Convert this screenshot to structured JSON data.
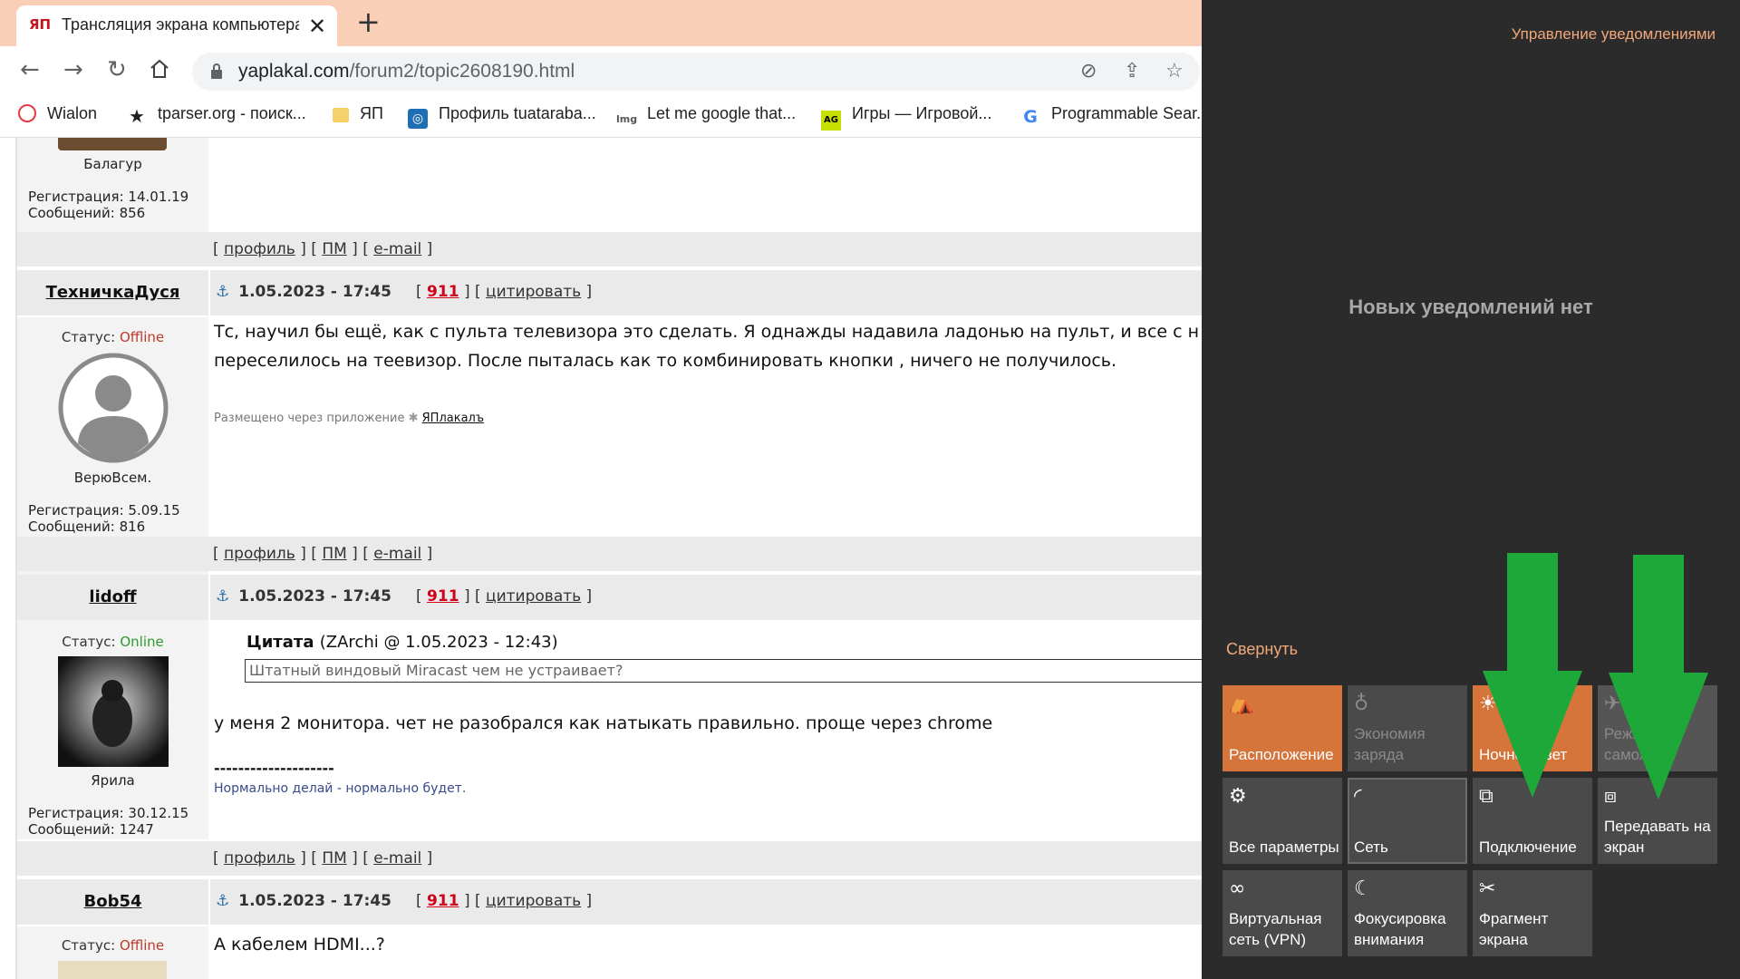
{
  "browser": {
    "tab_title": "Трансляция экрана компьютера",
    "tab_favicon": "ЯП",
    "close_glyph": "✕",
    "newtab_glyph": "+",
    "url_host": "yaplakal.com",
    "url_path": "/forum2/topic2608190.html",
    "bookmarks": [
      {
        "label": "Wialon",
        "icon": "wialon-icon"
      },
      {
        "label": "tparser.org - поиск...",
        "icon": "star-icon"
      },
      {
        "label": "ЯП",
        "icon": "folder-icon"
      },
      {
        "label": "Профиль tuataraba...",
        "icon": "profile-icon"
      },
      {
        "label": "Let me google that...",
        "icon": "lmgt-icon"
      },
      {
        "label": "Игры — Игровой...",
        "icon": "games-icon"
      },
      {
        "label": "Programmable Sear...",
        "icon": "google-icon"
      }
    ]
  },
  "forum": {
    "common": {
      "profile": "профиль",
      "pm": "ПМ",
      "email": "e-mail",
      "quote": "цитировать",
      "n911": "911",
      "status_label": "Статус:",
      "reg_label": "Регистрация:",
      "msgs_label": "Сообщений:"
    },
    "post0": {
      "rank": "Балагур",
      "reg": "14.01.19",
      "msgs": "856"
    },
    "post1": {
      "user": "ТехничкаДуся",
      "date": "1.05.2023 - 17:45",
      "status": "Offline",
      "rank": "ВерюВсем.",
      "reg": "5.09.15",
      "msgs": "816",
      "line1": "Тс, научил бы ещё, как с пульта телевизора это сделать. Я однажды надавила ладонью на пульт, и все с н",
      "line2": "переселилось на теевизор. После пыталась как то комбинировать кнопки , ничего не получилось.",
      "via": "Размещено через приложение",
      "app": "ЯПлакалъ"
    },
    "post2": {
      "user": "lidoff",
      "date": "1.05.2023 - 17:45",
      "status": "Online",
      "rank": "Ярила",
      "reg": "30.12.15",
      "msgs": "1247",
      "quote_title": "Цитата",
      "quote_meta": "(ZArchi @ 1.05.2023 - 12:43)",
      "quote_text": "Штатный виндовый Miracast чем не устраивает?",
      "text": "у меня 2 монитора. чет не разобрался как натыкать правильно. проще через chrome",
      "sig_sep": "--------------------",
      "signature": "Нормально делай - нормально будет."
    },
    "post3": {
      "user": "Bob54",
      "date": "1.05.2023 - 17:45",
      "status": "Offline",
      "text": "А кабелем HDMI...?"
    }
  },
  "action_center": {
    "manage": "Управление уведомлениями",
    "empty": "Новых уведомлений нет",
    "collapse": "Свернуть",
    "tiles": [
      {
        "label": "Расположение",
        "icon": "location-icon",
        "state": "on"
      },
      {
        "label": "Экономия заряда",
        "icon": "battery-saver-icon",
        "state": "disabled"
      },
      {
        "label": "Ночной свет",
        "icon": "brightness-icon",
        "state": "on"
      },
      {
        "label": "Режим самолета",
        "icon": "airplane-icon",
        "state": "off"
      },
      {
        "label": "Все параметры",
        "icon": "gear-icon",
        "state": "off"
      },
      {
        "label": "Сеть",
        "icon": "network-icon",
        "state": "off"
      },
      {
        "label": "Подключение",
        "icon": "connect-icon",
        "state": "off"
      },
      {
        "label": "Передавать на экран",
        "icon": "project-icon",
        "state": "off"
      },
      {
        "label": "Виртуальная сеть (VPN)",
        "icon": "vpn-icon",
        "state": "off"
      },
      {
        "label": "Фокусировка внимания",
        "icon": "moon-icon",
        "state": "off"
      },
      {
        "label": "Фрагмент экрана",
        "icon": "snip-icon",
        "state": "off"
      }
    ],
    "arrow_color": "#1fa83a",
    "accent": "#d5743b"
  }
}
